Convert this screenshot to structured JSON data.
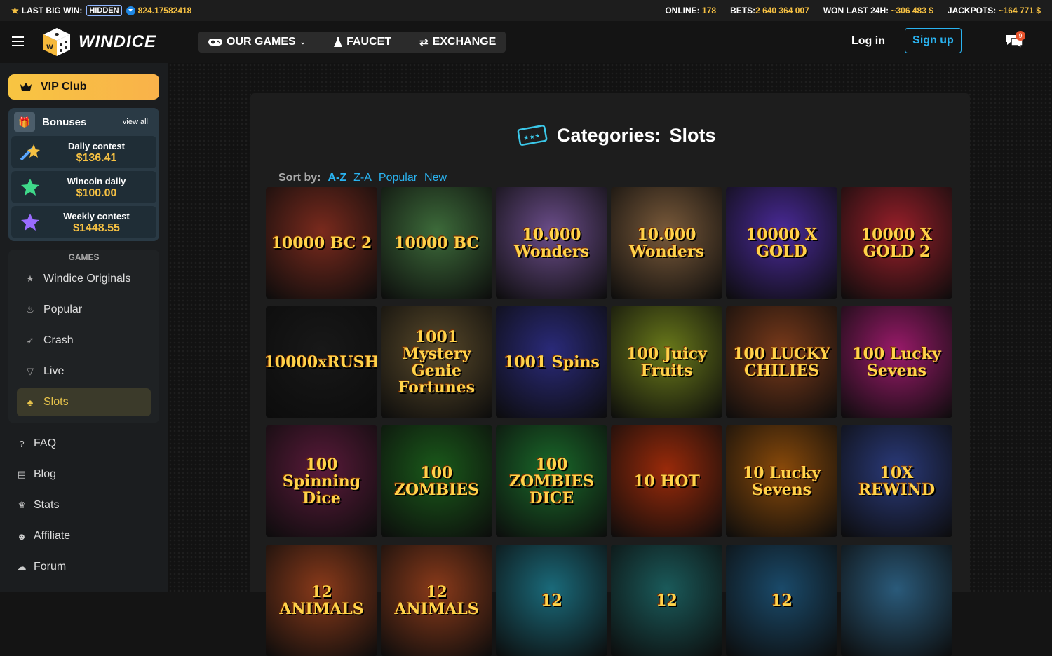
{
  "topbar": {
    "last_win_label": "LAST BIG WIN:",
    "hidden_label": "HIDDEN",
    "last_win_value": "824.17582418",
    "online_label": "ONLINE:",
    "online_value": "178",
    "bets_label": "BETS:",
    "bets_value": "2 640 364 007",
    "won_label": "WON LAST 24H:",
    "won_value": "~306 483 $",
    "jackpots_label": "JACKPOTS:",
    "jackpots_value": "~164 771 $"
  },
  "header": {
    "logo_text": "WINDICE",
    "nav": [
      {
        "label": "OUR GAMES"
      },
      {
        "label": "FAUCET"
      },
      {
        "label": "EXCHANGE"
      }
    ],
    "login_label": "Log in",
    "signup_label": "Sign up",
    "chat_badge": "9"
  },
  "sidebar": {
    "vip_label": "VIP Club",
    "bonuses_title": "Bonuses",
    "view_all": "view all",
    "bonuses": [
      {
        "name": "Daily contest",
        "amount": "$136.41"
      },
      {
        "name": "Wincoin daily",
        "amount": "$100.00"
      },
      {
        "name": "Weekly contest",
        "amount": "$1448.55"
      }
    ],
    "games_label": "GAMES",
    "games": [
      {
        "label": "Windice Originals",
        "icon": "star-icon"
      },
      {
        "label": "Popular",
        "icon": "fire-icon"
      },
      {
        "label": "Crash",
        "icon": "rocket-icon"
      },
      {
        "label": "Live",
        "icon": "cocktail-icon"
      },
      {
        "label": "Slots",
        "icon": "slot-icon"
      }
    ],
    "links": [
      {
        "label": "FAQ",
        "icon": "question-icon"
      },
      {
        "label": "Blog",
        "icon": "newspaper-icon"
      },
      {
        "label": "Stats",
        "icon": "trophy-icon"
      },
      {
        "label": "Affiliate",
        "icon": "users-icon"
      },
      {
        "label": "Forum",
        "icon": "comments-icon"
      }
    ]
  },
  "main": {
    "category_prefix": "Categories:",
    "category_name": "Slots",
    "sort_label": "Sort by:",
    "sort_options": [
      "A-Z",
      "Z-A",
      "Popular",
      "New"
    ],
    "games": [
      {
        "title": "10000 BC 2",
        "color": "#7a2a1d"
      },
      {
        "title": "10000 BC",
        "color": "#3d6b3a"
      },
      {
        "title": "10.000 Wonders",
        "color": "#6b4d8a"
      },
      {
        "title": "10.000 Wonders",
        "color": "#7a5a3a"
      },
      {
        "title": "10000 X GOLD",
        "color": "#4a2a9a"
      },
      {
        "title": "10000 X GOLD 2",
        "color": "#9a1f2a"
      },
      {
        "title": "10000xRUSH",
        "color": "#181818"
      },
      {
        "title": "1001 Mystery Genie Fortunes",
        "color": "#5a4a2a"
      },
      {
        "title": "1001 Spins",
        "color": "#2a2a7a"
      },
      {
        "title": "100 Juicy Fruits",
        "color": "#6a7a1a"
      },
      {
        "title": "100 LUCKY CHILIES",
        "color": "#7a3a1a"
      },
      {
        "title": "100 Lucky Sevens",
        "color": "#9a1a6a"
      },
      {
        "title": "100 Spinning Dice",
        "color": "#5a1a3a"
      },
      {
        "title": "100 ZOMBIES",
        "color": "#1a5a1a"
      },
      {
        "title": "100 ZOMBIES DICE",
        "color": "#1a6a2a"
      },
      {
        "title": "10 HOT",
        "color": "#9a2a0a"
      },
      {
        "title": "10 Lucky Sevens",
        "color": "#8a4a0a"
      },
      {
        "title": "10X REWIND",
        "color": "#2a3a7a"
      },
      {
        "title": "12 ANIMALS",
        "color": "#8a3a1a"
      },
      {
        "title": "12 ANIMALS",
        "color": "#8a3a1a"
      },
      {
        "title": "12",
        "color": "#1a6a7a"
      },
      {
        "title": "12",
        "color": "#1a5a5a"
      },
      {
        "title": "12",
        "color": "#1a4a6a"
      },
      {
        "title": "",
        "color": "#2a5a7a"
      }
    ]
  }
}
